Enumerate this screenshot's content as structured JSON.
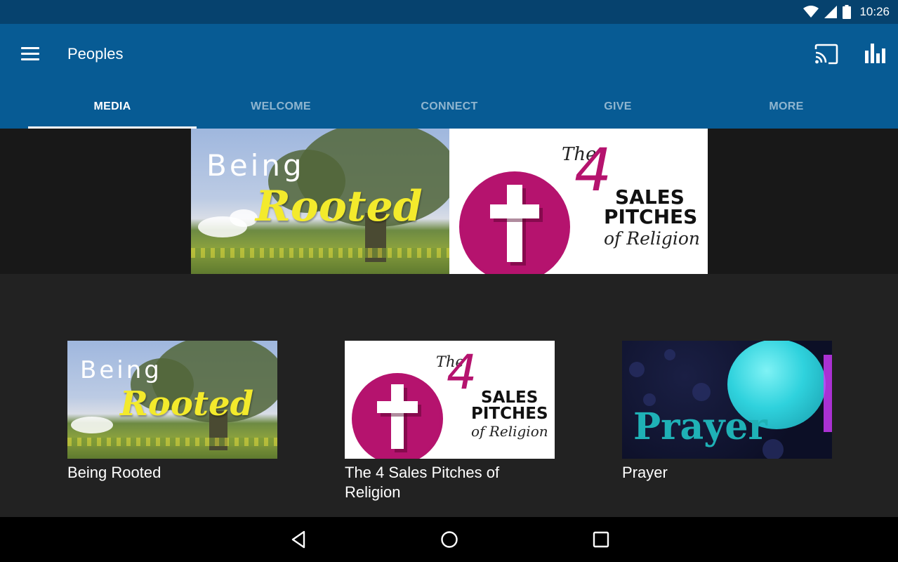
{
  "status_bar": {
    "time": "10:26",
    "icons": [
      "wifi-icon",
      "signal-icon",
      "battery-icon"
    ]
  },
  "app_bar": {
    "title": "Peoples",
    "actions": [
      "cast-icon",
      "bar-chart-icon"
    ],
    "color": "#075b94"
  },
  "tabs": [
    {
      "label": "MEDIA",
      "active": true
    },
    {
      "label": "WELCOME",
      "active": false
    },
    {
      "label": "CONNECT",
      "active": false
    },
    {
      "label": "GIVE",
      "active": false
    },
    {
      "label": "MORE",
      "active": false
    }
  ],
  "hero": {
    "banner_left": {
      "line1": "Being",
      "line2": "Rooted"
    },
    "banner_right": {
      "the": "The",
      "number": "4",
      "line1": "SALES",
      "line2": "PITCHES",
      "line3": "of Religion"
    }
  },
  "media_items": [
    {
      "title": "Being Rooted",
      "art": {
        "line1": "Being",
        "line2": "Rooted"
      }
    },
    {
      "title": "The 4 Sales Pitches of Religion",
      "art": {
        "the": "The",
        "number": "4",
        "line1": "SALES",
        "line2": "PITCHES",
        "line3": "of Religion"
      }
    },
    {
      "title": "Prayer",
      "art": {
        "word": "Prayer"
      }
    }
  ],
  "nav_bar": {
    "buttons": [
      "back-icon",
      "home-icon",
      "recents-icon"
    ]
  }
}
